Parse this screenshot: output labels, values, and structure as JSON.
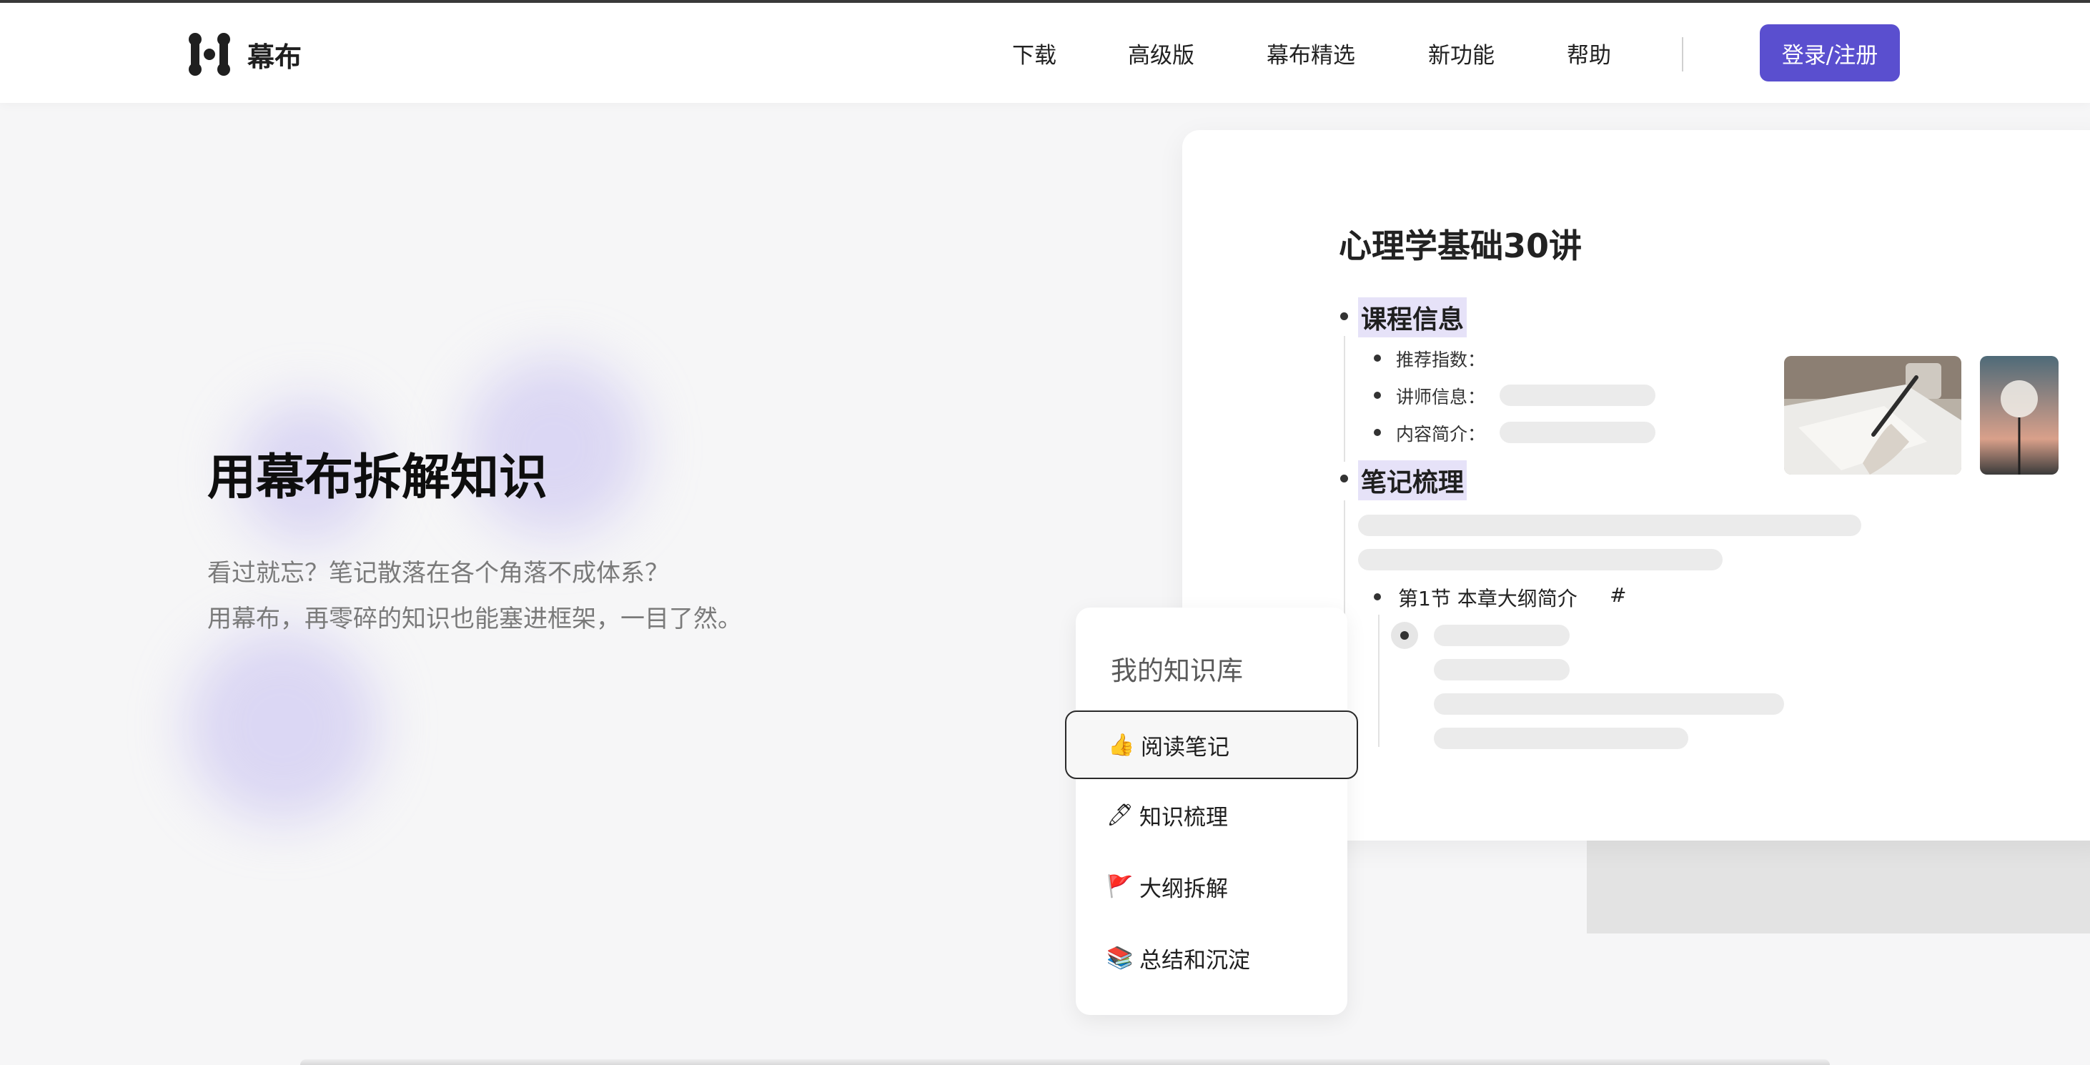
{
  "brand": {
    "name": "幕布"
  },
  "nav": {
    "items": [
      "下载",
      "高级版",
      "幕布精选",
      "新功能",
      "帮助"
    ],
    "login_label": "登录/注册"
  },
  "hero": {
    "title": "用幕布拆解知识",
    "subtitle_lines": [
      "看过就忘？笔记散落在各个角落不成体系？",
      "用幕布，再零碎的知识也能塞进框架，一目了然。"
    ]
  },
  "doc": {
    "title": "心理学基础30讲",
    "section1": {
      "heading": "课程信息",
      "items": [
        "推荐指数：",
        "讲师信息：",
        "内容简介："
      ]
    },
    "section2": {
      "heading": "笔记梳理",
      "sub": "第1节 本章大纲简介",
      "sub_hash": "#"
    }
  },
  "knowledge_base": {
    "title": "我的知识库",
    "items": [
      {
        "emoji": "👍",
        "label": "阅读笔记",
        "active": true
      },
      {
        "emoji": "🖊",
        "label": "知识梳理",
        "active": false
      },
      {
        "emoji": "🚩",
        "label": "大纲拆解",
        "active": false
      },
      {
        "emoji": "📚",
        "label": "总结和沉淀",
        "active": false
      }
    ]
  },
  "colors": {
    "accent": "#5a4fcf",
    "highlight": "#e6e2f8",
    "blob": "#bab2f0"
  },
  "icons": {
    "logo": "mubu-logo-icon"
  }
}
